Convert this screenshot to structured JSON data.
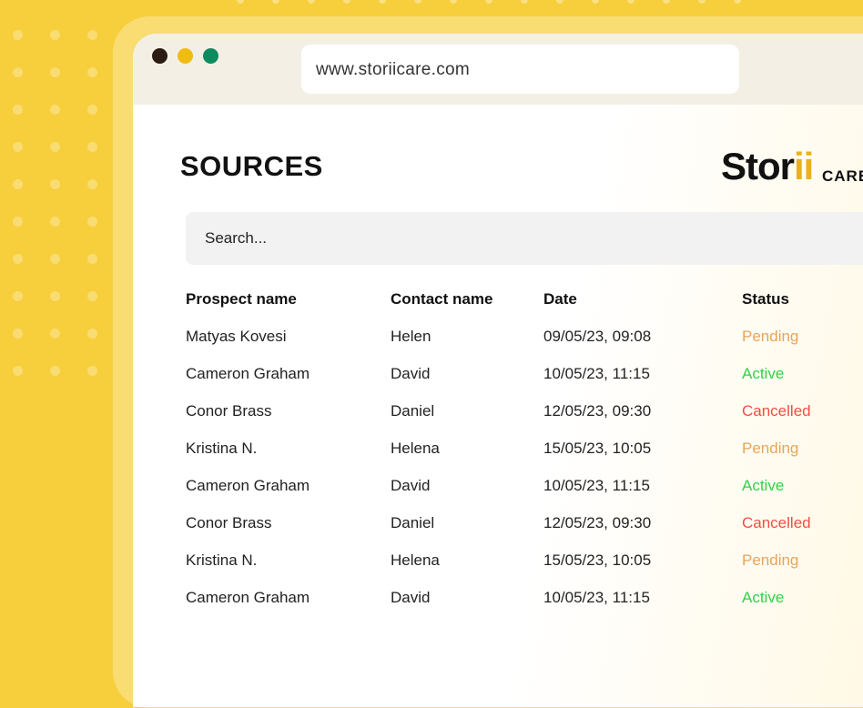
{
  "browser": {
    "url": "www.storiicare.com"
  },
  "page": {
    "title": "SOURCES"
  },
  "logo": {
    "main": "Storii",
    "sub": "CARE"
  },
  "search": {
    "placeholder": "Search..."
  },
  "table": {
    "columns": [
      "Prospect name",
      "Contact name",
      "Date",
      "Status"
    ],
    "rows": [
      {
        "prospect": "Matyas Kovesi",
        "contact": "Helen",
        "date": "09/05/23, 09:08",
        "status": "Pending"
      },
      {
        "prospect": "Cameron Graham",
        "contact": "David",
        "date": "10/05/23, 11:15",
        "status": "Active"
      },
      {
        "prospect": "Conor Brass",
        "contact": "Daniel",
        "date": "12/05/23, 09:30",
        "status": "Cancelled"
      },
      {
        "prospect": "Kristina N.",
        "contact": "Helena",
        "date": "15/05/23, 10:05",
        "status": "Pending"
      },
      {
        "prospect": "Cameron Graham",
        "contact": "David",
        "date": "10/05/23, 11:15",
        "status": "Active"
      },
      {
        "prospect": "Conor Brass",
        "contact": "Daniel",
        "date": "12/05/23, 09:30",
        "status": "Cancelled"
      },
      {
        "prospect": "Kristina N.",
        "contact": "Helena",
        "date": "15/05/23, 10:05",
        "status": "Pending"
      },
      {
        "prospect": "Cameron Graham",
        "contact": "David",
        "date": "10/05/23, 11:15",
        "status": "Active"
      }
    ]
  },
  "colors": {
    "background": "#f7cf3c",
    "pending": "#e6a55c",
    "active": "#34d04a",
    "cancelled": "#ef4f43",
    "traffic_close": "#2b1b10",
    "traffic_minimize": "#f0bc12",
    "traffic_maximize": "#0e8a5f"
  }
}
